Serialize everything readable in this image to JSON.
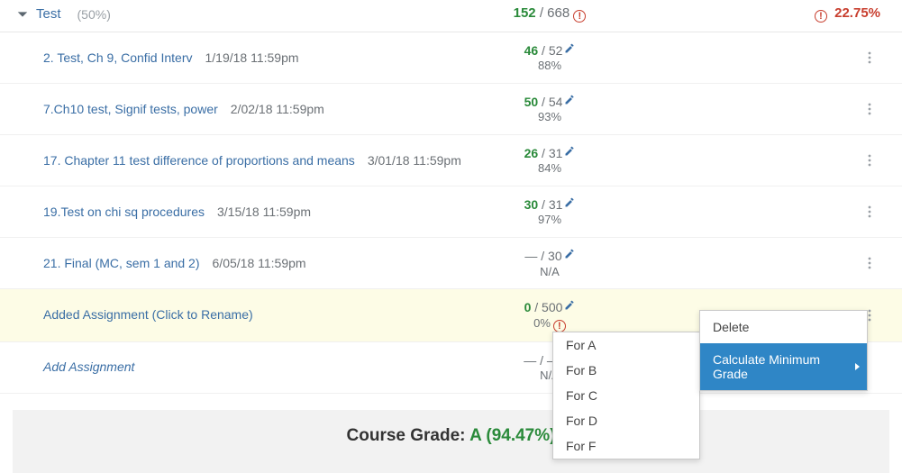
{
  "category": {
    "name": "Test",
    "weight": "(50%)",
    "points_earned": "152",
    "points_total": " / 668",
    "percent": "22.75%"
  },
  "items": [
    {
      "name": "2. Test, Ch 9, Confid Interv",
      "date": "1/19/18 11:59pm",
      "earned": "46",
      "outof": " / 52",
      "pct": "88%",
      "na": false,
      "alert": false
    },
    {
      "name": "7.Ch10 test, Signif tests, power",
      "date": "2/02/18 11:59pm",
      "earned": "50",
      "outof": " / 54",
      "pct": "93%",
      "na": false,
      "alert": false
    },
    {
      "name": "17. Chapter 11 test difference of proportions and means",
      "date": "3/01/18 11:59pm",
      "earned": "26",
      "outof": " / 31",
      "pct": "84%",
      "na": false,
      "alert": false
    },
    {
      "name": "19.Test on chi sq procedures",
      "date": "3/15/18 11:59pm",
      "earned": "30",
      "outof": " / 31",
      "pct": "97%",
      "na": false,
      "alert": false
    },
    {
      "name": "21. Final (MC, sem 1 and 2)",
      "date": "6/05/18 11:59pm",
      "earned": "—",
      "outof": " / 30",
      "pct": "N/A",
      "na": true,
      "alert": false
    },
    {
      "name": "Added Assignment (Click to Rename)",
      "date": "",
      "earned": "0",
      "outof": " / 500",
      "pct": "0%",
      "na": false,
      "alert": true,
      "hl": true
    }
  ],
  "addRow": {
    "label": "Add Assignment",
    "earned": "—",
    "outof": " / —",
    "pct": "N/A"
  },
  "courseGrade": {
    "label": "Course Grade: ",
    "value": "A (94.47%)"
  },
  "menu1": {
    "delete": "Delete",
    "calc": "Calculate Minimum Grade"
  },
  "menu2": [
    "For A",
    "For B",
    "For C",
    "For D",
    "For F"
  ]
}
